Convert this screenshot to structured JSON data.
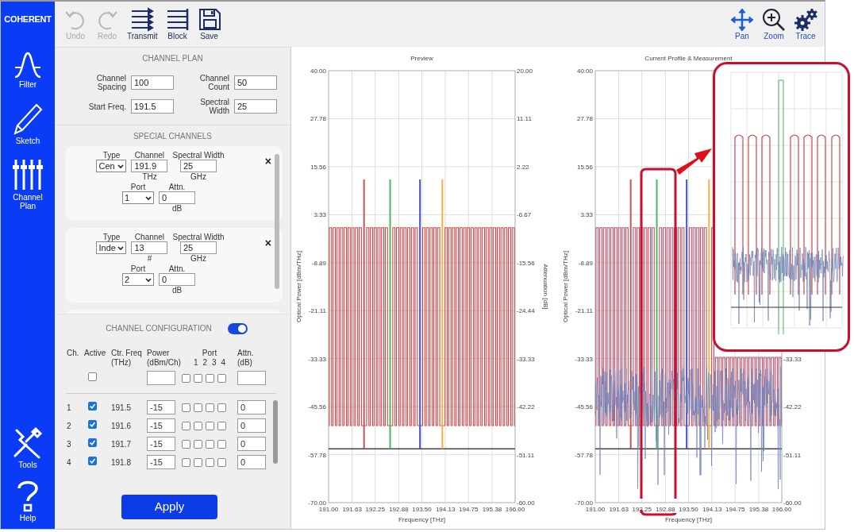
{
  "sidebar": {
    "logo": "COHERENT",
    "top_items": [
      {
        "kind": "filter",
        "label": "Filter"
      },
      {
        "kind": "sketch",
        "label": "Sketch"
      },
      {
        "kind": "sliders",
        "label": "Channel Plan"
      }
    ],
    "bottom_items": [
      {
        "kind": "tools",
        "label": "Tools"
      },
      {
        "kind": "help",
        "label": "Help"
      }
    ]
  },
  "toolbar": {
    "left": [
      {
        "kind": "undo",
        "label": "Undo",
        "disabled": true
      },
      {
        "kind": "redo",
        "label": "Redo",
        "disabled": true
      },
      {
        "kind": "transmit",
        "label": "Transmit",
        "disabled": false
      },
      {
        "kind": "block",
        "label": "Block",
        "disabled": false
      },
      {
        "kind": "save",
        "label": "Save",
        "disabled": false
      }
    ],
    "right": [
      {
        "kind": "pan",
        "label": "Pan"
      },
      {
        "kind": "zoom",
        "label": "Zoom"
      },
      {
        "kind": "trace",
        "label": "Trace"
      }
    ]
  },
  "channel_plan": {
    "title": "CHANNEL PLAN",
    "fields": [
      {
        "label": "Channel Spacing",
        "value": "100"
      },
      {
        "label": "Channel Count",
        "value": "50"
      },
      {
        "label": "Start Freq.",
        "value": "191.5"
      },
      {
        "label": "Spectral Width",
        "value": "25"
      }
    ]
  },
  "special_channels": {
    "title": "SPECIAL CHANNELS",
    "cards": [
      {
        "close": "×",
        "rows": [
          [
            {
              "kind": "select",
              "label": "Type",
              "value": "Cen"
            },
            {
              "kind": "input",
              "label": "Channel",
              "value": "191.9",
              "unit": "THz"
            },
            {
              "kind": "input",
              "label": "Spectral Width",
              "value": "25",
              "unit": "GHz"
            }
          ],
          [
            {
              "kind": "select",
              "label": "Port",
              "value": "1"
            },
            {
              "kind": "input",
              "label": "Attn.",
              "value": "0",
              "unit": "dB"
            }
          ]
        ]
      },
      {
        "close": "×",
        "rows": [
          [
            {
              "kind": "select",
              "label": "Type",
              "value": "Inde"
            },
            {
              "kind": "input",
              "label": "Channel",
              "value": "13",
              "unit": "#"
            },
            {
              "kind": "input",
              "label": "Spectral Width",
              "value": "25",
              "unit": "GHz"
            }
          ],
          [
            {
              "kind": "select",
              "label": "Port",
              "value": "2"
            },
            {
              "kind": "input",
              "label": "Attn.",
              "value": "0",
              "unit": "dB"
            }
          ]
        ]
      }
    ]
  },
  "channel_configuration": {
    "title": "CHANNEL CONFIGURATION",
    "on": true,
    "columns": [
      "Ch.",
      "Active",
      "Ctr. Freq (THz)",
      "Power (dBm/Ch)",
      "Port",
      "Attn. (dB)"
    ],
    "port_numbers": [
      "1",
      "2",
      "3",
      "4"
    ],
    "master": {
      "active": false,
      "ports": [
        {
          "checked": false
        },
        {
          "checked": false
        },
        {
          "checked": false
        },
        {
          "checked": false
        }
      ]
    },
    "rows": [
      {
        "ch": "1",
        "active": true,
        "freq": "191.5",
        "power": "-15",
        "ports": [
          {
            "checked": false
          },
          {
            "checked": false
          },
          {
            "checked": false
          },
          {
            "checked": false
          }
        ],
        "attn": "0"
      },
      {
        "ch": "2",
        "active": true,
        "freq": "191.6",
        "power": "-15",
        "ports": [
          {
            "checked": false
          },
          {
            "checked": false
          },
          {
            "checked": false
          },
          {
            "checked": false
          }
        ],
        "attn": "0"
      },
      {
        "ch": "3",
        "active": true,
        "freq": "191.7",
        "power": "-15",
        "ports": [
          {
            "checked": false
          },
          {
            "checked": false
          },
          {
            "checked": false
          },
          {
            "checked": false
          }
        ],
        "attn": "0"
      },
      {
        "ch": "4",
        "active": true,
        "freq": "191.8",
        "power": "-15",
        "ports": [
          {
            "checked": false
          },
          {
            "checked": false
          },
          {
            "checked": false
          },
          {
            "checked": false
          }
        ],
        "attn": "0"
      }
    ]
  },
  "apply_button": "Apply",
  "charts": [
    {
      "chart_data": {
        "type": "line",
        "title": "Preview",
        "xlabel": "Frequency [THz]",
        "ylabel": "Optical Power [dBm/THz]",
        "y2label": "Attenuation [dB]",
        "grid": true,
        "xlim": [
          191,
          196
        ],
        "ylim": [
          -70,
          40
        ],
        "y2lim": [
          -60,
          20
        ],
        "xticks": [
          {
            "value": 191,
            "label": "191.00"
          },
          {
            "value": 191.63,
            "label": "191.63"
          },
          {
            "value": 192.25,
            "label": "192.25"
          },
          {
            "value": 192.88,
            "label": "192.88"
          },
          {
            "value": 193.5,
            "label": "193.50"
          },
          {
            "value": 194.13,
            "label": "194.13"
          },
          {
            "value": 194.75,
            "label": "194.75"
          },
          {
            "value": 195.38,
            "label": "195.38"
          },
          {
            "value": 196,
            "label": "196.00"
          }
        ],
        "yticks": [
          {
            "value": 40,
            "label": "40.00"
          },
          {
            "value": 27.78,
            "label": "27.78"
          },
          {
            "value": 15.56,
            "label": "15.56"
          },
          {
            "value": 3.33,
            "label": "3.33"
          },
          {
            "value": -8.89,
            "label": "-8.89"
          },
          {
            "value": -21.11,
            "label": "-21.11"
          },
          {
            "value": -33.33,
            "label": "-33.33"
          },
          {
            "value": -45.56,
            "label": "-45.56"
          },
          {
            "value": -57.78,
            "label": "-57.78"
          },
          {
            "value": -70,
            "label": "-70.00"
          }
        ],
        "y2ticks": [
          {
            "value": 20,
            "label": "20.00"
          },
          {
            "value": 11.11,
            "label": "11.11"
          },
          {
            "value": 2.22,
            "label": "2.22"
          },
          {
            "value": -6.67,
            "label": "-6.67"
          },
          {
            "value": -15.56,
            "label": "-15.56"
          },
          {
            "value": -24.44,
            "label": "-24.44"
          },
          {
            "value": -33.33,
            "label": "-33.33"
          },
          {
            "value": -42.22,
            "label": "-42.22"
          },
          {
            "value": -51.11,
            "label": "-51.11"
          },
          {
            "value": -60,
            "label": "-60.00"
          }
        ],
        "series": [
          {
            "color": "#c9474a",
            "x": [
              191,
              191.02,
              191.02,
              191.08,
              191.08,
              191.12,
              191.12,
              191.18,
              191.18,
              191.22,
              191.22,
              191.28,
              191.28,
              191.32,
              191.32,
              191.38,
              191.38,
              191.42,
              191.42,
              191.48,
              191.48,
              191.52,
              191.52,
              191.58,
              191.58,
              191.62,
              191.62,
              191.68,
              191.68,
              191.72,
              191.72,
              191.78,
              191.78,
              191.82,
              191.82,
              191.88,
              191.88,
              192.02,
              192.02,
              192.08,
              192.08,
              192.12,
              192.12,
              192.18,
              192.18,
              192.22,
              192.22,
              192.28,
              192.28,
              192.32,
              192.32,
              192.38,
              192.38,
              192.42,
              192.42,
              192.48,
              192.48,
              192.52,
              192.52,
              192.58,
              192.58,
              192.72,
              192.72,
              192.78,
              192.78,
              192.82,
              192.82,
              192.88,
              192.88,
              192.92,
              192.92,
              192.98,
              192.98,
              193.02,
              193.02,
              193.08,
              193.08,
              193.12,
              193.12,
              193.18,
              193.18,
              193.22,
              193.22,
              193.28,
              193.28,
              193.32,
              193.32,
              193.38,
              193.38,
              193.52,
              193.52,
              193.58,
              193.58,
              193.62,
              193.62,
              193.68,
              193.68,
              193.72,
              193.72,
              193.78,
              193.78,
              193.82,
              193.82,
              193.88,
              193.88,
              193.92,
              193.92,
              193.98,
              193.98,
              194.12,
              194.12,
              194.18,
              194.18,
              194.22,
              194.22,
              194.28,
              194.28,
              194.32,
              194.32,
              194.38,
              194.38,
              194.42,
              194.42,
              194.48,
              194.48,
              194.52,
              194.52,
              194.58,
              194.58,
              194.62,
              194.62,
              194.68,
              194.68,
              194.72,
              194.72,
              194.78,
              194.78,
              194.82,
              194.82,
              194.88,
              194.88,
              194.92,
              194.92,
              194.98,
              194.98,
              195.02,
              195.02,
              195.08,
              195.08,
              195.12,
              195.12,
              195.18,
              195.18,
              195.22,
              195.22,
              195.28,
              195.28,
              195.32,
              195.32,
              195.38,
              195.38,
              195.42,
              195.42,
              195.48,
              195.48,
              195.52,
              195.52,
              195.58,
              195.58,
              195.62,
              195.62,
              195.68,
              195.68,
              195.72,
              195.72,
              195.78,
              195.78,
              195.82,
              195.82,
              195.88,
              195.88,
              195.92,
              195.92,
              195.98,
              195.98,
              196
            ],
            "values": [
              -50.4,
              -50.4,
              0,
              0,
              -50.4,
              -50.4,
              0,
              0,
              -50.4,
              -50.4,
              0,
              0,
              -50.4,
              -50.4,
              0,
              0,
              -50.4,
              -50.4,
              0,
              0,
              -50.4,
              -50.4,
              0,
              0,
              -50.4,
              -50.4,
              0,
              0,
              -50.4,
              -50.4,
              0,
              0,
              -50.4,
              -50.4,
              0,
              0,
              -50.4,
              -50.4,
              0,
              0,
              -50.4,
              -50.4,
              0,
              0,
              -50.4,
              -50.4,
              0,
              0,
              -50.4,
              -50.4,
              0,
              0,
              -50.4,
              -50.4,
              0,
              0,
              -50.4,
              -50.4,
              0,
              0,
              -50.4,
              -50.4,
              0,
              0,
              -50.4,
              -50.4,
              0,
              0,
              -50.4,
              -50.4,
              0,
              0,
              -50.4,
              -50.4,
              0,
              0,
              -50.4,
              -50.4,
              0,
              0,
              -50.4,
              -50.4,
              0,
              0,
              -50.4,
              -50.4,
              0,
              0,
              -50.4,
              -50.4,
              0,
              0,
              -50.4,
              -50.4,
              0,
              0,
              -50.4,
              -50.4,
              0,
              0,
              -50.4,
              -50.4,
              0,
              0,
              -50.4,
              -50.4,
              0,
              0,
              -50.4,
              -50.4,
              0,
              0,
              -50.4,
              -50.4,
              0,
              0,
              -50.4,
              -50.4,
              0,
              0,
              -50.4,
              -50.4,
              0,
              0,
              -50.4,
              -50.4,
              0,
              0,
              -50.4,
              -50.4,
              0,
              0,
              -50.4,
              -50.4,
              0,
              0,
              -50.4,
              -50.4,
              0,
              0,
              -50.4,
              -50.4,
              0,
              0,
              -50.4,
              -50.4,
              0,
              0,
              -50.4,
              -50.4,
              0,
              0,
              -50.4,
              -50.4,
              0,
              0,
              -50.4,
              -50.4,
              0,
              0,
              -50.4,
              -50.4,
              0,
              0,
              -50.4,
              -50.4,
              0,
              0,
              -50.4,
              -50.4,
              0,
              0,
              -50.4,
              -50.4,
              0,
              0,
              -50.4,
              -50.4,
              0,
              0,
              -50.4,
              -50.4,
              0,
              0,
              -50.4,
              -50.4
            ]
          },
          {
            "color": "#444444",
            "x": [
              191,
              196
            ],
            "values": [
              -56.3,
              -56.3
            ]
          },
          {
            "color": "#d0504f",
            "x": [
              191.95,
              191.95
            ],
            "values": [
              -56.3,
              12.3
            ]
          },
          {
            "color": "#4cb85a",
            "x": [
              192.65,
              192.65
            ],
            "values": [
              -56.3,
              12.3
            ]
          },
          {
            "color": "#4a4fd0",
            "x": [
              193.45,
              193.45
            ],
            "values": [
              -56.3,
              12.3
            ]
          },
          {
            "color": "#f0b43a",
            "x": [
              194.05,
              194.05
            ],
            "values": [
              -56.3,
              12.3
            ]
          }
        ]
      }
    },
    {
      "chart_data": {
        "type": "line",
        "title": "Current Profile & Measurement",
        "xlabel": "Frequency [THz]",
        "ylabel": "Optical Power [dBm/THz]",
        "grid": true,
        "xlim": [
          191,
          196
        ],
        "ylim": [
          -70,
          40
        ],
        "y2lim": [
          -60,
          20
        ],
        "xticks": [
          {
            "value": 191,
            "label": "191.00"
          },
          {
            "value": 191.63,
            "label": "191.63"
          },
          {
            "value": 192.25,
            "label": "192.25"
          },
          {
            "value": 192.88,
            "label": "192.88"
          },
          {
            "value": 193.5,
            "label": "193.50"
          },
          {
            "value": 194.13,
            "label": "194.13"
          },
          {
            "value": 194.75,
            "label": "194.75"
          },
          {
            "value": 195.38,
            "label": "195.38"
          },
          {
            "value": 196,
            "label": "196.00"
          }
        ],
        "yticks": [
          {
            "value": 40,
            "label": "40.00"
          },
          {
            "value": 27.78,
            "label": "27.78"
          },
          {
            "value": 15.56,
            "label": "15.56"
          },
          {
            "value": 3.33,
            "label": "3.33"
          },
          {
            "value": -8.89,
            "label": "-8.89"
          },
          {
            "value": -21.11,
            "label": "-21.11"
          },
          {
            "value": -33.33,
            "label": "-33.33"
          },
          {
            "value": -45.56,
            "label": "-45.56"
          },
          {
            "value": -57.78,
            "label": "-57.78"
          },
          {
            "value": -70,
            "label": "-70.00"
          }
        ],
        "y2ticks": [
          {
            "value": -33.33,
            "label": "-33.33"
          },
          {
            "value": -42.22,
            "label": "-42.22"
          },
          {
            "value": -51.11,
            "label": "-51.11"
          },
          {
            "value": -60,
            "label": "-60.00"
          }
        ],
        "series": [
          {
            "color": "#b9506a",
            "x": [
              191,
              191.02,
              191.02,
              191.08,
              191.08,
              191.12,
              191.12,
              191.18,
              191.18,
              191.22,
              191.22,
              191.28,
              191.28,
              191.32,
              191.32,
              191.38,
              191.38,
              191.42,
              191.42,
              191.48,
              191.48,
              191.52,
              191.52,
              191.58,
              191.58,
              191.62,
              191.62,
              191.68,
              191.68,
              191.72,
              191.72,
              191.78,
              191.78,
              191.82,
              191.82,
              191.88,
              191.88,
              192.02,
              192.02,
              192.08,
              192.08,
              192.12,
              192.12,
              192.18,
              192.18,
              192.22,
              192.22,
              192.28,
              192.28,
              192.32,
              192.32,
              192.38,
              192.38,
              192.42,
              192.42,
              192.48,
              192.48,
              192.52,
              192.52,
              192.58,
              192.58,
              192.72,
              192.72,
              192.78,
              192.78,
              192.82,
              192.82,
              192.88,
              192.88,
              192.92,
              192.92,
              192.98,
              192.98,
              193.02,
              193.02,
              193.08,
              193.08,
              193.12,
              193.12,
              193.18,
              193.18,
              193.22,
              193.22,
              193.28,
              193.28,
              193.32,
              193.32,
              193.38,
              193.38,
              193.52,
              193.52,
              193.58,
              193.58,
              193.62,
              193.62,
              193.68,
              193.68,
              193.72,
              193.72,
              193.78,
              193.78,
              193.82,
              193.82,
              193.88,
              193.88,
              193.92,
              193.92,
              193.98,
              193.98,
              194.12,
              194.12,
              194.18,
              194.18,
              194.22,
              194.22,
              194.28,
              194.28,
              194.32,
              194.32,
              194.38,
              194.38,
              194.42,
              194.42,
              194.48,
              194.48,
              194.52,
              194.52,
              194.58,
              194.58,
              194.62,
              194.62,
              194.68,
              194.68,
              194.72,
              194.72,
              194.78,
              194.78,
              194.82,
              194.82,
              194.88,
              194.88,
              194.92,
              194.92,
              194.98,
              194.98,
              195.02,
              195.02,
              195.08,
              195.08,
              195.12,
              195.12,
              195.18,
              195.18,
              195.22,
              195.22,
              195.28,
              195.28,
              195.32,
              195.32,
              195.38,
              195.38,
              195.42,
              195.42,
              195.48,
              195.48,
              195.52,
              195.52,
              195.58,
              195.58,
              195.62,
              195.62,
              195.68,
              195.68,
              195.72,
              195.72,
              195.78,
              195.78,
              195.82,
              195.82,
              195.88,
              195.88,
              195.92,
              195.92,
              195.98,
              195.98,
              196
            ],
            "values": [
              -50.4,
              -50.4,
              0,
              0,
              -50.4,
              -50.4,
              0,
              0,
              -50.4,
              -50.4,
              0,
              0,
              -50.4,
              -50.4,
              0,
              0,
              -50.4,
              -50.4,
              0,
              0,
              -50.4,
              -50.4,
              0,
              0,
              -50.4,
              -50.4,
              0,
              0,
              -50.4,
              -50.4,
              0,
              0,
              -50.4,
              -50.4,
              0,
              0,
              -50.4,
              -50.4,
              0,
              0,
              -50.4,
              -50.4,
              0,
              0,
              -50.4,
              -50.4,
              0,
              0,
              -50.4,
              -50.4,
              0,
              0,
              -50.4,
              -50.4,
              0,
              0,
              -50.4,
              -50.4,
              0,
              0,
              -50.4,
              -50.4,
              0,
              0,
              -50.4,
              -50.4,
              0,
              0,
              -50.4,
              -50.4,
              0,
              0,
              -50.4,
              -50.4,
              0,
              0,
              -50.4,
              -50.4,
              0,
              0,
              -50.4,
              -50.4,
              0,
              0,
              -50.4,
              -50.4,
              0,
              0,
              -50.4,
              -50.4,
              0,
              0,
              -50.4,
              -50.4,
              0,
              0,
              -50.4,
              -50.4,
              0,
              0,
              -50.4,
              -50.4,
              0,
              0,
              -50.4,
              -50.4,
              0,
              0,
              -50.4,
              -50.4,
              0,
              0,
              -50.4,
              -50.4,
              -33,
              -33,
              -50.4,
              -50.4,
              -33,
              -33,
              -50.4,
              -50.4,
              -33,
              -33,
              -50.4,
              -50.4,
              -33,
              -33,
              -50.4,
              -50.4,
              -33,
              -33,
              -50.4,
              -50.4,
              -33,
              -33,
              -50.4,
              -50.4,
              -33,
              -33,
              -50.4,
              -50.4,
              -33,
              -33,
              -50.4,
              -50.4,
              -33,
              -33,
              -50.4,
              -50.4,
              -33,
              -33,
              -50.4,
              -50.4,
              -33,
              -33,
              -50.4,
              -50.4,
              -33,
              -33,
              -50.4,
              -50.4,
              -33,
              -33,
              -50.4,
              -50.4,
              -33,
              -33,
              -50.4,
              -50.4,
              -33,
              -33,
              -50.4,
              -50.4,
              -33,
              -33,
              -50.4,
              -50.4,
              -33,
              -33,
              -50.4,
              -50.4,
              -33,
              -33,
              -50.4,
              -50.4
            ]
          },
          {
            "color": "#444444",
            "x": [
              191,
              196
            ],
            "values": [
              -56.3,
              -56.3
            ]
          },
          {
            "color": "#d0504f",
            "x": [
              191.95,
              191.95
            ],
            "values": [
              -56.3,
              12.3
            ]
          },
          {
            "color": "#4cb85a",
            "x": [
              192.65,
              192.65
            ],
            "values": [
              -56.3,
              12.3
            ]
          },
          {
            "color": "#4a4fd0",
            "x": [
              193.45,
              193.45
            ],
            "values": [
              -56.3,
              12.3
            ]
          },
          {
            "color": "#f0b43a",
            "x": [
              194.05,
              194.05
            ],
            "values": [
              -56.3,
              12.3
            ]
          }
        ]
      }
    }
  ]
}
